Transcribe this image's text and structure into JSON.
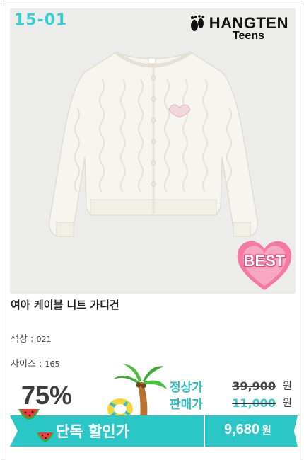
{
  "product": {
    "code": "15-01",
    "brand_name": "HANGTEN",
    "brand_sub": "Teens",
    "badge": "BEST",
    "title": "여아 케이블 니트 가디건"
  },
  "options": {
    "color_label": "색상 :",
    "color_value": "021",
    "size_label": "사이즈 :",
    "size_value": "165"
  },
  "pricing": {
    "discount_percent": "75%",
    "regular_label": "정상가",
    "regular_price": "39,900",
    "sale_label": "판매가",
    "sale_price": "11,000",
    "currency": "원",
    "promo_label": "단독 할인가",
    "final_price": "9,680",
    "final_currency": "원"
  },
  "colors": {
    "accent": "#2bc7c6",
    "code": "#33d0d4",
    "badge": "#f47aa3"
  }
}
